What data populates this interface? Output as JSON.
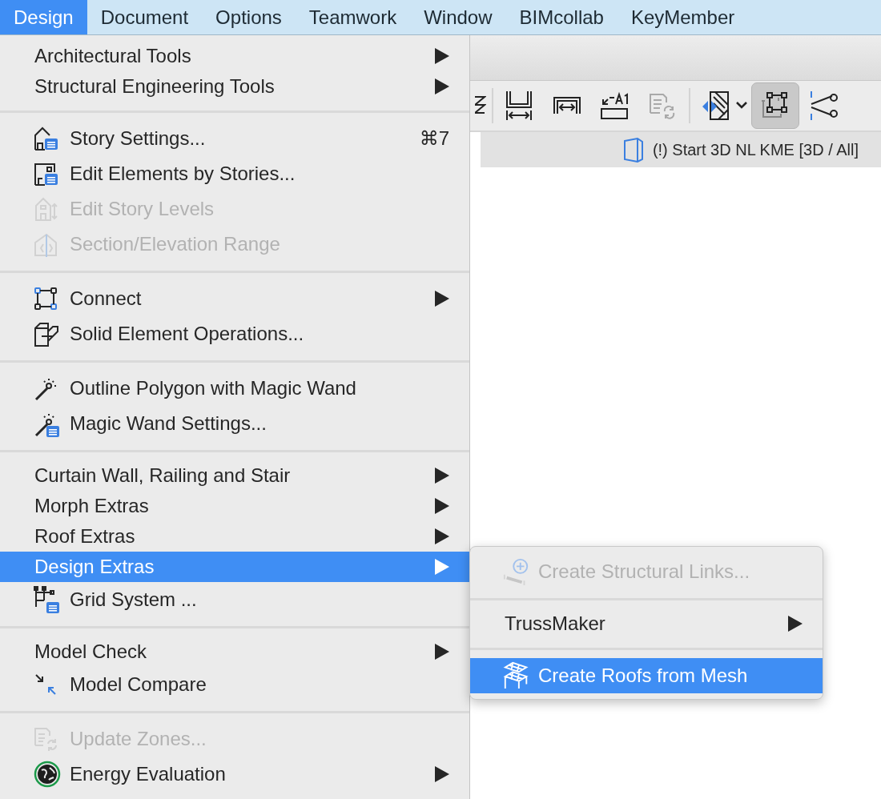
{
  "menubar": [
    {
      "label": "Design",
      "selected": true
    },
    {
      "label": "Document",
      "selected": false
    },
    {
      "label": "Options",
      "selected": false
    },
    {
      "label": "Teamwork",
      "selected": false
    },
    {
      "label": "Window",
      "selected": false
    },
    {
      "label": "BIMcollab",
      "selected": false
    },
    {
      "label": "KeyMember",
      "selected": false
    }
  ],
  "toolbar": {
    "buttons": [
      {
        "selected": false,
        "disabled": false
      },
      {
        "selected": false,
        "disabled": false
      },
      {
        "selected": false,
        "disabled": false
      },
      {
        "selected": false,
        "disabled": false
      },
      {
        "selected": false,
        "disabled": true
      },
      {
        "selected": false,
        "disabled": false
      },
      {
        "selected": true,
        "disabled": false
      },
      {
        "selected": false,
        "disabled": false
      }
    ]
  },
  "view_tab": {
    "title": "(!) Start 3D NL KME [3D / All]"
  },
  "menu": {
    "sections": [
      [
        {
          "kind": "plain",
          "label": "Architectural Tools",
          "submenu": true,
          "disabled": false,
          "selected": false
        },
        {
          "kind": "plain",
          "label": "Structural Engineering Tools",
          "submenu": true,
          "disabled": false,
          "selected": false
        }
      ],
      [
        {
          "kind": "icon",
          "label": "Story Settings...",
          "shortcut": "⌘7",
          "submenu": false,
          "disabled": false,
          "selected": false
        },
        {
          "kind": "icon",
          "label": "Edit Elements by Stories...",
          "submenu": false,
          "disabled": false,
          "selected": false
        },
        {
          "kind": "icon",
          "label": "Edit Story Levels",
          "submenu": false,
          "disabled": true,
          "selected": false
        },
        {
          "kind": "icon",
          "label": "Section/Elevation Range",
          "submenu": false,
          "disabled": true,
          "selected": false
        }
      ],
      [
        {
          "kind": "icon",
          "label": "Connect",
          "submenu": true,
          "disabled": false,
          "selected": false
        },
        {
          "kind": "icon",
          "label": "Solid Element Operations...",
          "submenu": false,
          "disabled": false,
          "selected": false
        }
      ],
      [
        {
          "kind": "icon",
          "label": "Outline Polygon with Magic Wand",
          "submenu": false,
          "disabled": false,
          "selected": false
        },
        {
          "kind": "icon",
          "label": "Magic Wand Settings...",
          "submenu": false,
          "disabled": false,
          "selected": false
        }
      ],
      [
        {
          "kind": "plain",
          "label": "Curtain Wall, Railing and Stair",
          "submenu": true,
          "disabled": false,
          "selected": false
        },
        {
          "kind": "plain",
          "label": "Morph Extras",
          "submenu": true,
          "disabled": false,
          "selected": false
        },
        {
          "kind": "plain",
          "label": "Roof Extras",
          "submenu": true,
          "disabled": false,
          "selected": false
        },
        {
          "kind": "plain",
          "label": "Design Extras",
          "submenu": true,
          "disabled": false,
          "selected": true
        },
        {
          "kind": "icon",
          "label": "Grid System ...",
          "submenu": false,
          "disabled": false,
          "selected": false
        }
      ],
      [
        {
          "kind": "plain",
          "label": "Model Check",
          "submenu": true,
          "disabled": false,
          "selected": false
        },
        {
          "kind": "icon",
          "label": "Model Compare",
          "submenu": false,
          "disabled": false,
          "selected": false
        }
      ],
      [
        {
          "kind": "icon",
          "label": "Update Zones...",
          "submenu": false,
          "disabled": true,
          "selected": false
        },
        {
          "kind": "icon",
          "label": "Energy Evaluation",
          "submenu": true,
          "disabled": false,
          "selected": false
        }
      ]
    ]
  },
  "submenu": {
    "sections": [
      [
        {
          "kind": "icon",
          "label": "Create Structural Links...",
          "submenu": false,
          "disabled": true,
          "selected": false
        }
      ],
      [
        {
          "kind": "plain",
          "label": "TrussMaker",
          "submenu": true,
          "disabled": false,
          "selected": false
        }
      ],
      [
        {
          "kind": "icon",
          "label": "Create Roofs from Mesh",
          "submenu": false,
          "disabled": false,
          "selected": true
        }
      ]
    ]
  }
}
